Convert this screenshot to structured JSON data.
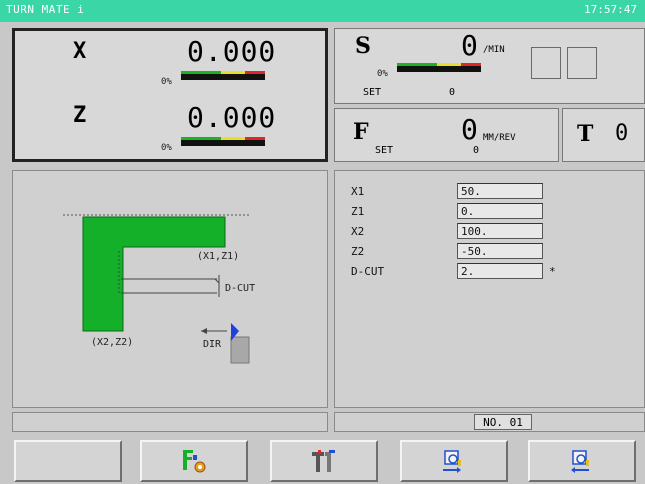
{
  "titlebar": {
    "title": "TURN MATE i",
    "clock": "17:57:47"
  },
  "axes": [
    {
      "label": "X",
      "value": "0.000",
      "load_pct": "0%"
    },
    {
      "label": "Z",
      "value": "0.000",
      "load_pct": "0%"
    }
  ],
  "spindle": {
    "label": "S",
    "value": "0",
    "unit": "/MIN",
    "load_pct": "0%",
    "set_label": "SET",
    "set_value": "0"
  },
  "feed": {
    "label": "F",
    "value": "0",
    "unit": "MM/REV",
    "set_label": "SET",
    "set_value": "0"
  },
  "tool": {
    "label": "T",
    "value": "0"
  },
  "graphic": {
    "p1_label": "(X1,Z1)",
    "p2_label": "(X2,Z2)",
    "dcut_label": "D-CUT",
    "dir_label": "DIR"
  },
  "params": [
    {
      "label": "X1",
      "value": "50."
    },
    {
      "label": "Z1",
      "value": "0."
    },
    {
      "label": "X2",
      "value": "100."
    },
    {
      "label": "Z2",
      "value": "-50."
    },
    {
      "label": "D-CUT",
      "value": "2."
    }
  ],
  "dcut_marker": "*",
  "status": {
    "program_no": "NO. 01"
  },
  "softkeys": [
    {
      "label": "",
      "icon": "blank"
    },
    {
      "label": "",
      "icon": "feed-speed-icon"
    },
    {
      "label": "",
      "icon": "tool-setting-icon"
    },
    {
      "label": "",
      "icon": "prev-page-icon"
    },
    {
      "label": "",
      "icon": "next-page-icon"
    }
  ],
  "colors": {
    "titlebar": "#3ad6a6",
    "workpiece": "#14b02a",
    "load_green": "#19b324",
    "load_yellow": "#e8e026",
    "load_red": "#e02626"
  }
}
